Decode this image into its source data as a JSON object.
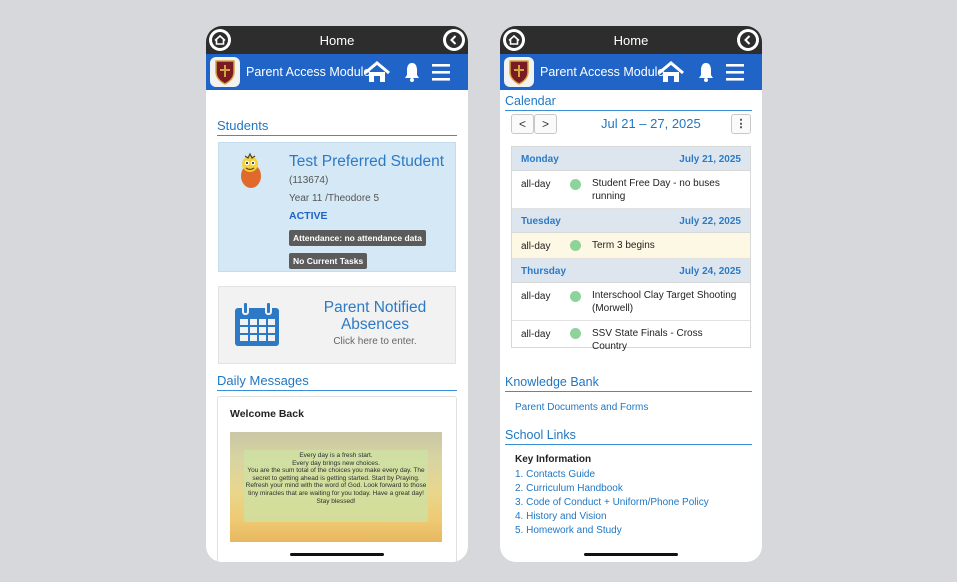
{
  "left": {
    "status_title": "Home",
    "app_title": "Parent Access Module",
    "students_heading": "Students",
    "student": {
      "name": "Test Preferred Student",
      "id": "(113674)",
      "year": "Year 11 /Theodore 5",
      "status": "ACTIVE",
      "attendance": "Attendance: no attendance data",
      "tasks": "No Current Tasks"
    },
    "absences": {
      "title": "Parent Notified Absences",
      "subtitle": "Click here to enter."
    },
    "daily_messages_heading": "Daily Messages",
    "message": {
      "title": "Welcome Back",
      "body": "Every day is a fresh start.\nEvery day brings new choices.\nYou are the sum total of the choices you make every day. The secret to getting ahead is getting started.  Start by Praying. Refresh your mind with the word of God. Look forward to those tiny miracles that are waiting for you today. Have a great day! Stay blessed!"
    }
  },
  "right": {
    "status_title": "Home",
    "app_title": "Parent Access Module",
    "calendar_heading": "Calendar",
    "nav_prev": "<",
    "nav_next": ">",
    "date_range": "Jul 21 – 27, 2025",
    "more": "⋮",
    "days": [
      {
        "name": "Monday",
        "date": "July 21, 2025",
        "events": [
          {
            "time": "all-day",
            "title": "Student Free Day - no buses running",
            "highlight": false
          }
        ]
      },
      {
        "name": "Tuesday",
        "date": "July 22, 2025",
        "events": [
          {
            "time": "all-day",
            "title": "Term 3 begins",
            "highlight": true
          }
        ]
      },
      {
        "name": "Thursday",
        "date": "July 24, 2025",
        "events": [
          {
            "time": "all-day",
            "title": "Interschool Clay Target Shooting (Morwell)",
            "highlight": false
          },
          {
            "time": "all-day",
            "title": "SSV State Finals - Cross Country",
            "highlight": false
          }
        ]
      }
    ],
    "knowledge_heading": "Knowledge Bank",
    "knowledge_link": "Parent Documents and Forms",
    "school_links_heading": "School Links",
    "key_info": "Key Information",
    "links": [
      "1. Contacts Guide",
      "2. Curriculum Handbook",
      "3. Code of Conduct + Uniform/Phone Policy",
      "4. History and Vision",
      "5. Homework and Study"
    ]
  },
  "colors": {
    "appbar": "#1f64c6",
    "statusbar": "#2d2d2d",
    "accent_text": "#1f77c4",
    "event_dot": "#8fd39a",
    "highlight_row": "#fcf8e3"
  },
  "icons": [
    "home-circle-icon",
    "back-circle-icon",
    "school-crest-icon",
    "home-icon",
    "bell-icon",
    "menu-icon",
    "calendar-icon",
    "chevron-left-icon",
    "chevron-right-icon",
    "kebab-icon"
  ]
}
